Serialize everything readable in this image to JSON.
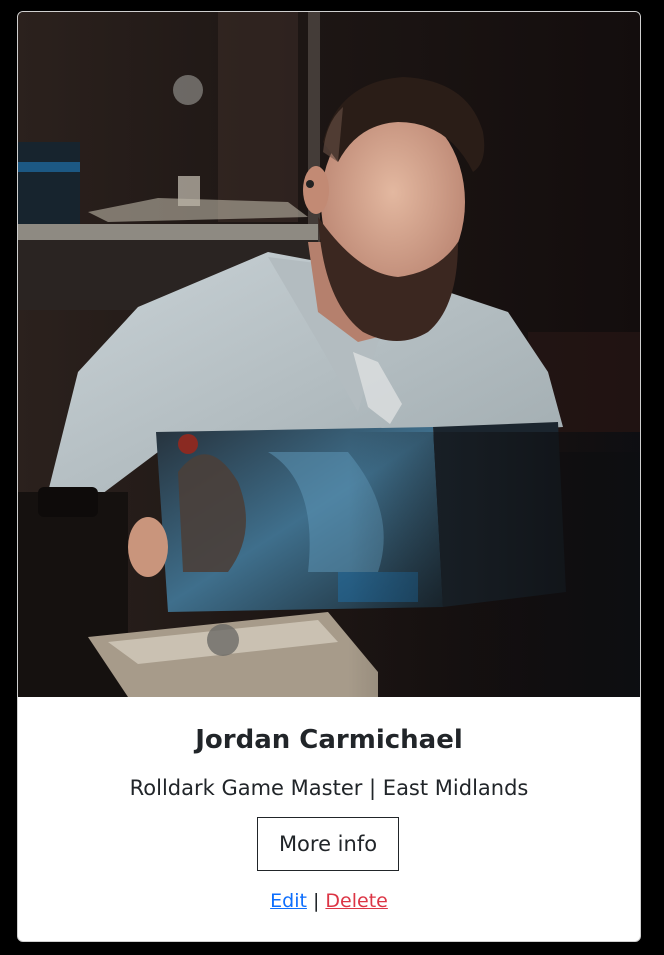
{
  "card": {
    "image_subject": "bearded-game-master-reading-map",
    "name": "Jordan Carmichael",
    "role": "Rolldark Game Master | East Midlands",
    "more_info_label": "More info",
    "edit_label": "Edit",
    "separator": "|",
    "delete_label": "Delete"
  },
  "colors": {
    "link": "#0d6efd",
    "danger": "#dc3545",
    "text": "#212529",
    "background": "#000000",
    "card": "#ffffff"
  }
}
